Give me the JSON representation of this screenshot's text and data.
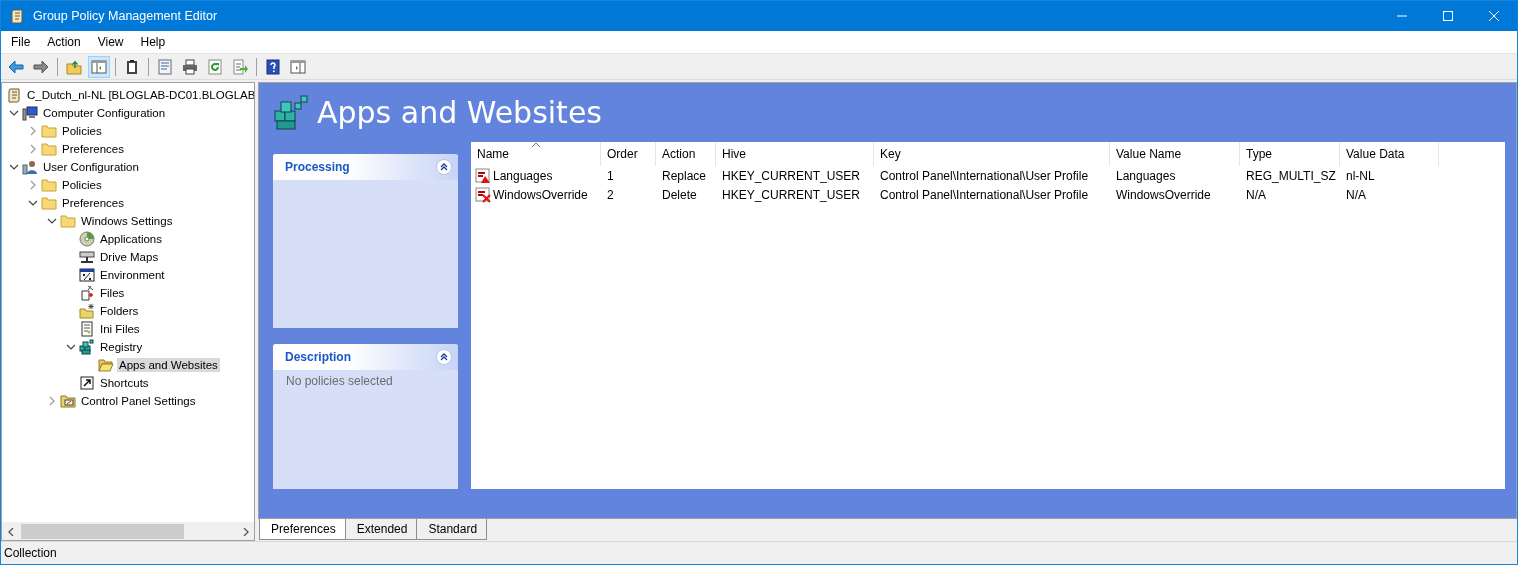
{
  "window": {
    "title": "Group Policy Management Editor"
  },
  "menu": [
    "File",
    "Action",
    "View",
    "Help"
  ],
  "toolbar": [
    [
      {
        "kind": "back",
        "pressed": false
      },
      {
        "kind": "forward",
        "pressed": false
      }
    ],
    [
      {
        "kind": "up",
        "pressed": false
      },
      {
        "kind": "tree",
        "pressed": true
      }
    ],
    [
      {
        "kind": "clipboard",
        "pressed": false
      }
    ],
    [
      {
        "kind": "properties",
        "pressed": false
      },
      {
        "kind": "print",
        "pressed": false
      },
      {
        "kind": "refresh",
        "pressed": false
      },
      {
        "kind": "export",
        "pressed": false
      }
    ],
    [
      {
        "kind": "help",
        "pressed": false
      },
      {
        "kind": "pane",
        "pressed": false
      }
    ]
  ],
  "tree": {
    "label": "C_Dutch_nl-NL [BLOGLAB-DC01.BLOGLAB",
    "kind": "gpo",
    "selected": false,
    "children": [
      {
        "label": "Computer Configuration",
        "kind": "computer",
        "expanded": true,
        "selected": false,
        "children": [
          {
            "label": "Policies",
            "kind": "folder",
            "expanded": false,
            "selected": false
          },
          {
            "label": "Preferences",
            "kind": "folder",
            "expanded": false,
            "selected": false
          }
        ]
      },
      {
        "label": "User Configuration",
        "kind": "user",
        "expanded": true,
        "selected": false,
        "children": [
          {
            "label": "Policies",
            "kind": "folder",
            "expanded": false,
            "selected": false
          },
          {
            "label": "Preferences",
            "kind": "folder",
            "expanded": true,
            "selected": false,
            "children": [
              {
                "label": "Windows Settings",
                "kind": "folder",
                "expanded": true,
                "selected": false,
                "children": [
                  {
                    "label": "Applications",
                    "kind": "disc",
                    "selected": false
                  },
                  {
                    "label": "Drive Maps",
                    "kind": "drive",
                    "selected": false
                  },
                  {
                    "label": "Environment",
                    "kind": "percent",
                    "selected": false
                  },
                  {
                    "label": "Files",
                    "kind": "files",
                    "selected": false
                  },
                  {
                    "label": "Folders",
                    "kind": "folders",
                    "selected": false
                  },
                  {
                    "label": "Ini Files",
                    "kind": "ini",
                    "selected": false
                  },
                  {
                    "label": "Registry",
                    "kind": "registry",
                    "expanded": true,
                    "selected": false,
                    "children": [
                      {
                        "label": "Apps and Websites",
                        "kind": "openfolder",
                        "selected": true
                      }
                    ]
                  },
                  {
                    "label": "Shortcuts",
                    "kind": "shortcut",
                    "selected": false
                  }
                ]
              },
              {
                "label": "Control Panel Settings",
                "kind": "control",
                "expanded": false,
                "selected": false
              }
            ]
          }
        ]
      }
    ]
  },
  "header": {
    "title": "Apps and Websites"
  },
  "panels": [
    {
      "title": "Processing",
      "expanded": true
    },
    {
      "title": "Description",
      "expanded": true,
      "text": "No policies selected"
    }
  ],
  "table": {
    "columns": [
      {
        "label": "Name",
        "sorted": true
      },
      {
        "label": "Order",
        "sorted": false
      },
      {
        "label": "Action",
        "sorted": false
      },
      {
        "label": "Hive",
        "sorted": false
      },
      {
        "label": "Key",
        "sorted": false
      },
      {
        "label": "Value Name",
        "sorted": false
      },
      {
        "label": "Type",
        "sorted": false
      },
      {
        "label": "Value Data",
        "sorted": false
      }
    ],
    "rows": [
      {
        "kind": "replace",
        "cells": [
          "Languages",
          "1",
          "Replace",
          "HKEY_CURRENT_USER",
          "Control Panel\\International\\User Profile",
          "Languages",
          "REG_MULTI_SZ",
          "nl-NL"
        ]
      },
      {
        "kind": "delete",
        "cells": [
          "WindowsOverride",
          "2",
          "Delete",
          "HKEY_CURRENT_USER",
          "Control Panel\\International\\User Profile",
          "WindowsOverride",
          "N/A",
          "N/A"
        ]
      }
    ]
  },
  "tabs": [
    {
      "label": "Preferences",
      "selected": true
    },
    {
      "label": "Extended",
      "selected": false
    },
    {
      "label": "Standard",
      "selected": false
    }
  ],
  "status_bar": {
    "text": "Collection"
  }
}
